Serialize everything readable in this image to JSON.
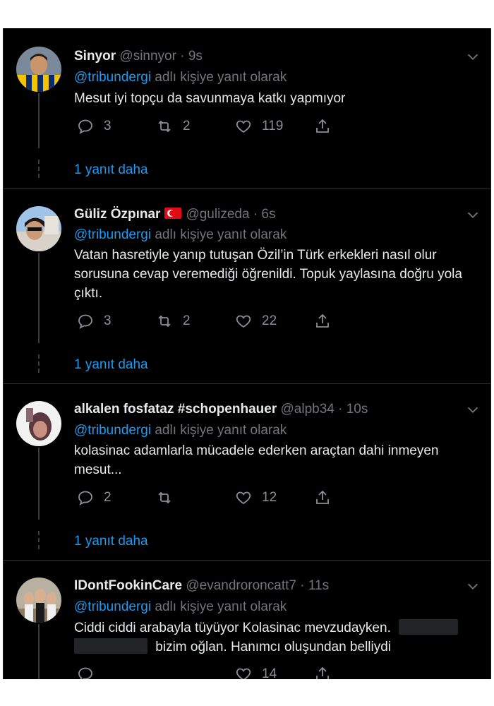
{
  "tweets": [
    {
      "name": "Sinyor",
      "handle": "@sinnyor",
      "sep": "·",
      "time": "9s",
      "reply_mention": "@tribundergi",
      "reply_suffix": "adlı kişiye yanıt olarak",
      "body": "Mesut iyi topçu da savunmaya katkı yapmıyor",
      "replies": "3",
      "retweets": "2",
      "likes": "119",
      "more_replies": "1 yanıt daha"
    },
    {
      "name": "Güliz Özpınar",
      "handle": "@gulizeda",
      "sep": "·",
      "time": "6s",
      "reply_mention": "@tribundergi",
      "reply_suffix": "adlı kişiye yanıt olarak",
      "body": "Vatan hasretiyle yanıp tutuşan Özil’in Türk erkekleri nasıl olur sorusuna cevap veremediği öğrenildi. Topuk yaylasına doğru yola çıktı.",
      "replies": "3",
      "retweets": "2",
      "likes": "22",
      "more_replies": "1 yanıt daha"
    },
    {
      "name": "alkalen fosfataz #schopenhauer",
      "handle": "@alpb34",
      "sep": "·",
      "time": "10s",
      "reply_mention": "@tribundergi",
      "reply_suffix": "adlı kişiye yanıt olarak",
      "body": "kolasinac adamlarla mücadele ederken araçtan dahi inmeyen mesut...",
      "replies": "2",
      "retweets": "",
      "likes": "12",
      "more_replies": "1 yanıt daha"
    },
    {
      "name": "IDontFookinCare",
      "handle": "@evandroroncatt7",
      "sep": "·",
      "time": "11s",
      "reply_mention": "@tribundergi",
      "reply_suffix": "adlı kişiye yanıt olarak",
      "body_line1": "Ciddi ciddi arabayla tüyüyor Kolasinac mevzudayken.",
      "body_line2": "bizim oğlan. Hanımcı oluşundan belliydi",
      "replies": "",
      "retweets": "",
      "likes": "14"
    }
  ],
  "icons": {
    "reply": "reply-icon",
    "retweet": "retweet-icon",
    "like": "heart-icon",
    "share": "share-icon",
    "more": "chevron-down-icon",
    "flag": "turkey-flag-icon"
  },
  "colors": {
    "background": "#000000",
    "text": "#e7e9ea",
    "muted": "#71767b",
    "link": "#1d9bf0"
  }
}
